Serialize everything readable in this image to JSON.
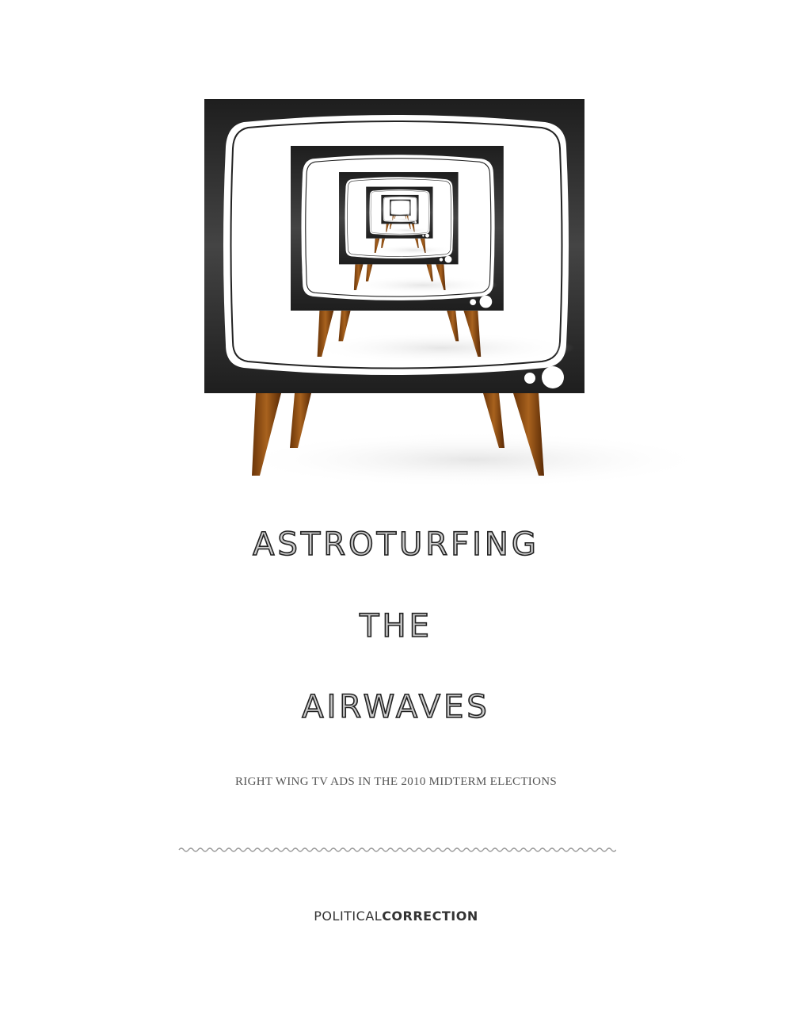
{
  "cover": {
    "title_lines": [
      "ASTROTURFING",
      "THE",
      "AIRWAVES"
    ],
    "subtitle": "RIGHT WING TV ADS IN THE 2010 MIDTERM ELECTIONS",
    "publisher": {
      "light": "POLITICAL",
      "bold": "CORRECTION"
    }
  },
  "colors": {
    "tv_body": "#262626",
    "wood": "#8a4a12",
    "text": "#333333"
  }
}
